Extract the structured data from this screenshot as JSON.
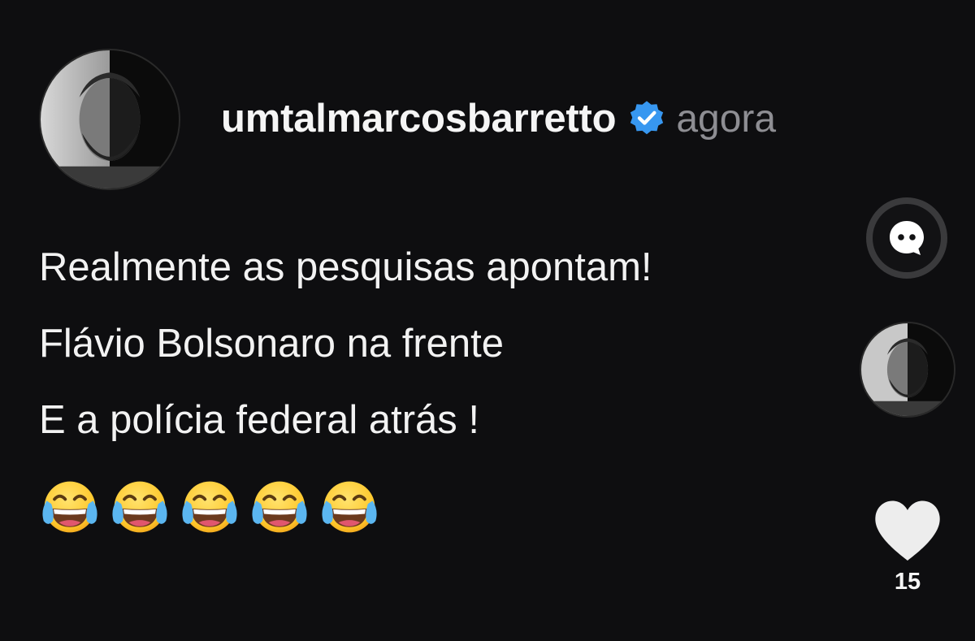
{
  "post": {
    "username": "umtalmarcosbarretto",
    "timestamp": "agora",
    "verified": true,
    "lines": [
      "Realmente as pesquisas apontam!",
      "Flávio Bolsonaro na frente",
      "E a polícia federal atrás !"
    ],
    "emojis": [
      "😂",
      "😂",
      "😂",
      "😂",
      "😂"
    ]
  },
  "actions": {
    "likes": "15"
  },
  "icons": {
    "verified": "verified-badge-icon",
    "chat": "chat-bubble-icon",
    "like": "heart-icon",
    "emoji": "face-with-tears-of-joy"
  },
  "colors": {
    "background": "#0e0e10",
    "verified_blue": "#3797f0",
    "muted_text": "#8e8e93"
  }
}
